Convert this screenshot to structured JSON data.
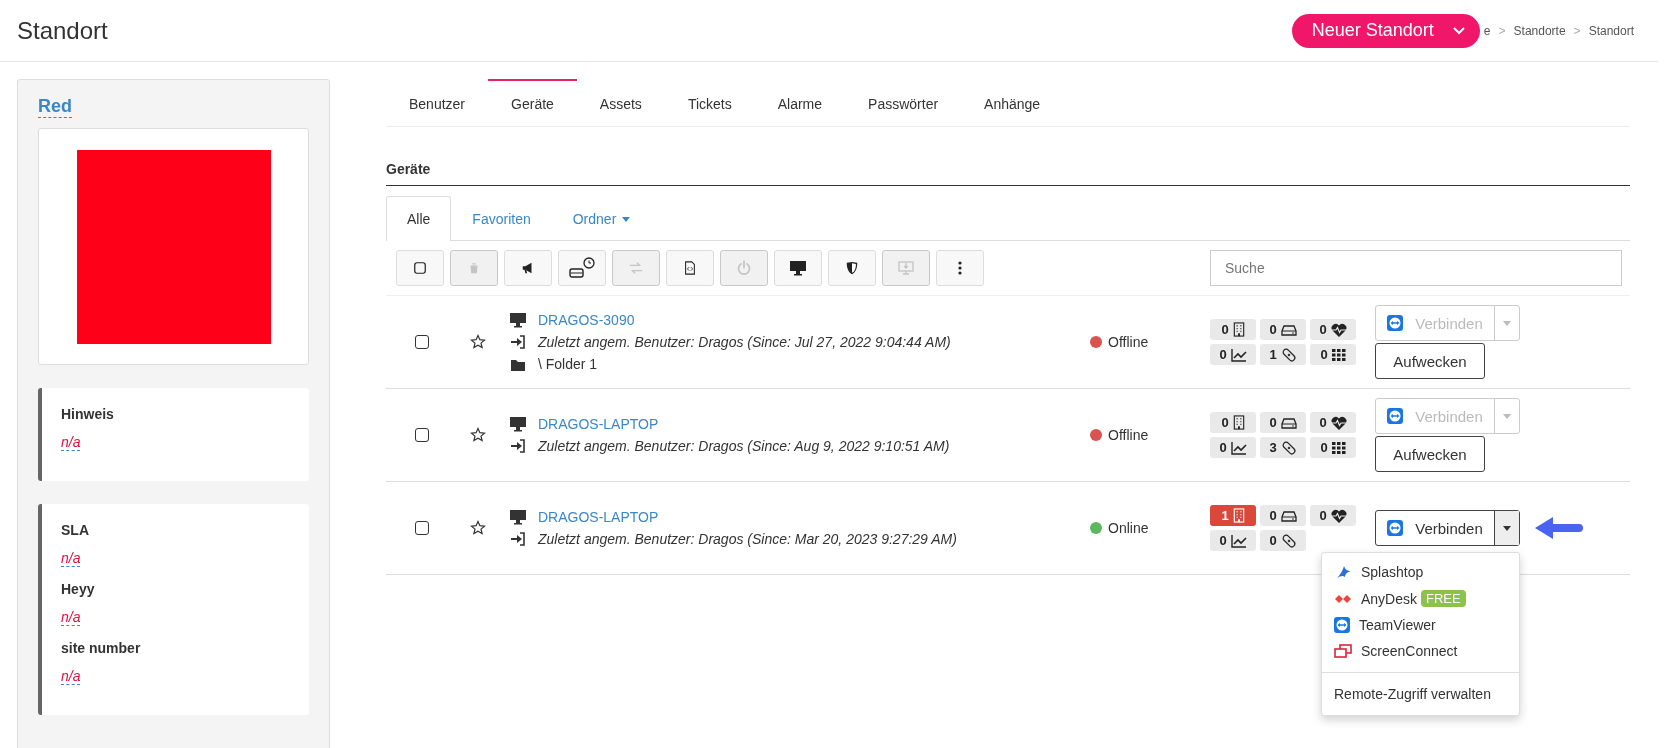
{
  "header": {
    "title": "Standort",
    "new_button": "Neuer Standort",
    "breadcrumb": [
      "e",
      ">",
      "Standorte",
      ">",
      "Standort"
    ]
  },
  "sidebar": {
    "name": "Red",
    "cards": [
      {
        "fields": [
          {
            "label": "Hinweis",
            "value": "n/a"
          }
        ]
      },
      {
        "fields": [
          {
            "label": "SLA",
            "value": "n/a"
          },
          {
            "label": "Heyy",
            "value": "n/a"
          },
          {
            "label": "site number",
            "value": "n/a"
          }
        ]
      }
    ]
  },
  "tabs": [
    {
      "label": "Benutzer",
      "selected": false
    },
    {
      "label": "Geräte",
      "selected": true
    },
    {
      "label": "Assets",
      "selected": false
    },
    {
      "label": "Tickets",
      "selected": false
    },
    {
      "label": "Alarme",
      "selected": false
    },
    {
      "label": "Passwörter",
      "selected": false
    },
    {
      "label": "Anhänge",
      "selected": false
    }
  ],
  "section_title": "Geräte",
  "subtabs": [
    {
      "label": "Alle",
      "selected": true,
      "dropdown": false
    },
    {
      "label": "Favoriten",
      "selected": false,
      "dropdown": false
    },
    {
      "label": "Ordner",
      "selected": false,
      "dropdown": true
    }
  ],
  "toolbar": [
    {
      "kind": "checkbox",
      "disabled": false
    },
    {
      "kind": "trash",
      "disabled": true
    },
    {
      "kind": "megaphone",
      "disabled": false
    },
    {
      "kind": "drive",
      "disabled": false
    },
    {
      "kind": "transfer",
      "disabled": true
    },
    {
      "kind": "script",
      "disabled": false
    },
    {
      "kind": "power",
      "disabled": true
    },
    {
      "kind": "monitor",
      "disabled": false
    },
    {
      "kind": "shield",
      "disabled": false
    },
    {
      "kind": "download",
      "disabled": true
    },
    {
      "kind": "more",
      "disabled": false
    }
  ],
  "search": {
    "placeholder": "Suche"
  },
  "devices": [
    {
      "checked": false,
      "name": "DRAGOS-3090",
      "user": "Zuletzt angem. Benutzer: Dragos (Since: Jul 27, 2022 9:04:44 AM)",
      "folder": "\\ Folder 1",
      "status": "Offline",
      "color": "#d9534f",
      "badges": [
        {
          "count": "0",
          "kind": "building",
          "alert": false
        },
        {
          "count": "0",
          "kind": "drive",
          "alert": false
        },
        {
          "count": "0",
          "kind": "heart",
          "alert": false
        },
        {
          "count": "0",
          "kind": "chart",
          "alert": false
        },
        {
          "count": "1",
          "kind": "patch",
          "alert": false
        },
        {
          "count": "0",
          "kind": "grid",
          "alert": false
        }
      ],
      "connect": "Verbinden",
      "connect_disabled": true,
      "menu_open": false,
      "wake": "Aufwecken"
    },
    {
      "checked": false,
      "name": "DRAGOS-LAPTOP",
      "user": "Zuletzt angem. Benutzer: Dragos (Since: Aug 9, 2022 9:10:51 AM)",
      "status": "Offline",
      "color": "#d9534f",
      "badges": [
        {
          "count": "0",
          "kind": "building",
          "alert": false
        },
        {
          "count": "0",
          "kind": "drive",
          "alert": false
        },
        {
          "count": "0",
          "kind": "heart",
          "alert": false
        },
        {
          "count": "0",
          "kind": "chart",
          "alert": false
        },
        {
          "count": "3",
          "kind": "patch",
          "alert": false
        },
        {
          "count": "0",
          "kind": "grid",
          "alert": false
        }
      ],
      "connect": "Verbinden",
      "connect_disabled": true,
      "menu_open": false,
      "wake": "Aufwecken"
    },
    {
      "checked": false,
      "name": "DRAGOS-LAPTOP",
      "user": "Zuletzt angem. Benutzer: Dragos (Since: Mar 20, 2023 9:27:29 AM)",
      "status": "Online",
      "color": "#5cb85c",
      "badges": [
        {
          "count": "1",
          "kind": "building",
          "alert": true
        },
        {
          "count": "0",
          "kind": "drive",
          "alert": false
        },
        {
          "count": "0",
          "kind": "heart",
          "alert": false
        },
        {
          "count": "0",
          "kind": "chart",
          "alert": false
        },
        {
          "count": "0",
          "kind": "patch",
          "alert": false
        }
      ],
      "connect": "Verbinden",
      "connect_disabled": false,
      "menu_open": true
    }
  ],
  "connect_menu": {
    "items": [
      {
        "label": "Splashtop",
        "kind": "splashtop"
      },
      {
        "label": "AnyDesk",
        "kind": "anydesk",
        "tag": "FREE"
      },
      {
        "label": "TeamViewer",
        "kind": "teamviewer"
      },
      {
        "label": "ScreenConnect",
        "kind": "screenconnect"
      }
    ],
    "footer": "Remote-Zugriff verwalten"
  }
}
